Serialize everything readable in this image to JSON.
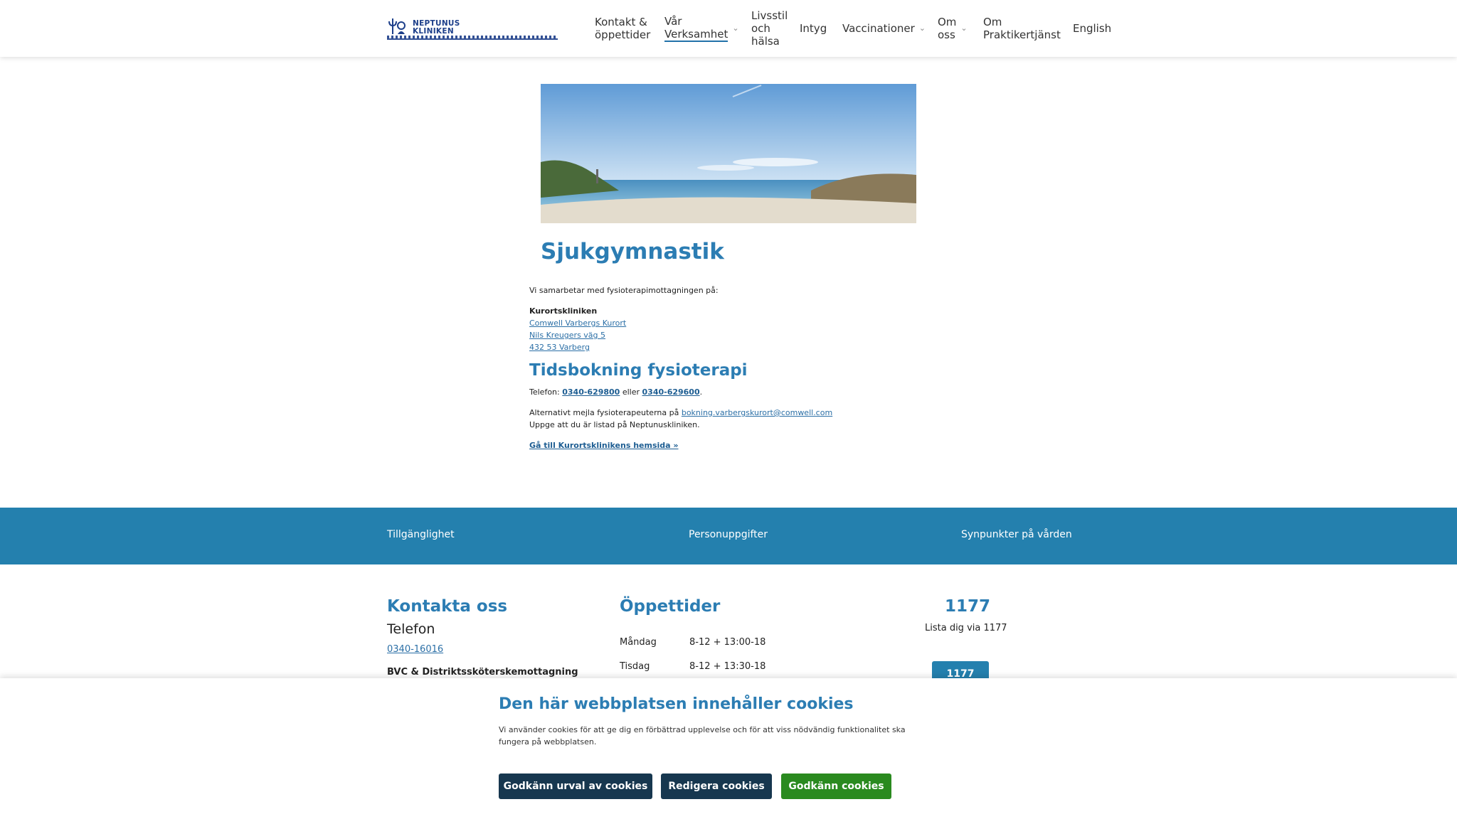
{
  "header": {
    "logo_text_line1": "NEPTUNUS",
    "logo_text_line2": "KLINIKEN",
    "nav": [
      {
        "label": "Kontakt &\nöppettider"
      },
      {
        "label": "Vår\nVerksamhet",
        "dropdown": true,
        "active": true
      },
      {
        "label": "Livsstil\noch\nhälsa"
      },
      {
        "label": "Intyg"
      },
      {
        "label": "Vaccinationer",
        "dropdown": true
      },
      {
        "label": "Om\noss",
        "dropdown": true
      },
      {
        "label": "Om\nPraktikertjänst"
      },
      {
        "label": "English"
      }
    ]
  },
  "main": {
    "title": "Sjukgymnastik",
    "intro": "Vi samarbetar med fysioterapimottagningen på:",
    "clinic_name": "Kurortskliniken",
    "address_links": [
      "Comwell Varbergs Kurort",
      "Nils Kreugers väg 5",
      "432 53 Varberg"
    ],
    "booking_title": "Tidsbokning fysioterapi",
    "phone_prefix": "Telefon:",
    "phone1": "0340-629800",
    "phone_or": "eller",
    "phone2": "0340-629600",
    "phone_suffix": ".",
    "email_prefix": "Alternativt mejla fysioterapeuterna på",
    "email": "bokning.varbergskurort@comwell.com",
    "note": "Uppge att du är listad på Neptunuskliniken.",
    "homepage_link": "Gå till Kurortsklinikens hemsida »"
  },
  "footer_bar": {
    "items": [
      "Tillgänglighet",
      "Personuppgifter",
      "Synpunkter på vården"
    ]
  },
  "footer": {
    "contact_title": "Kontakta oss",
    "phone_heading": "Telefon",
    "phone_number": "0340-16016",
    "bvc_heading": "BVC & Distriktssköterskemottagning",
    "hours_title": "Öppettider",
    "hours": [
      {
        "day": "Måndag",
        "time": "8-12 + 13:00-18"
      },
      {
        "day": "Tisdag",
        "time": "8-12 + 13:30-18"
      }
    ],
    "t1177_title": "1177",
    "t1177_text": "Lista dig via 1177",
    "t1177_button": "1177"
  },
  "cookie": {
    "title": "Den här webbplatsen innehåller cookies",
    "text": "Vi använder cookies för att ge dig en förbättrad upplevelse och för att viss nödvändig funktionalitet ska fungera på webbplatsen.",
    "btn_approve_selection": "Godkänn urval av cookies",
    "btn_edit": "Redigera cookies",
    "btn_approve": "Godkänn cookies"
  },
  "colors": {
    "accent": "#2c7db3",
    "footer_bar": "#2480ae",
    "dark_button": "#17374f",
    "green_button": "#2a8a1f"
  }
}
